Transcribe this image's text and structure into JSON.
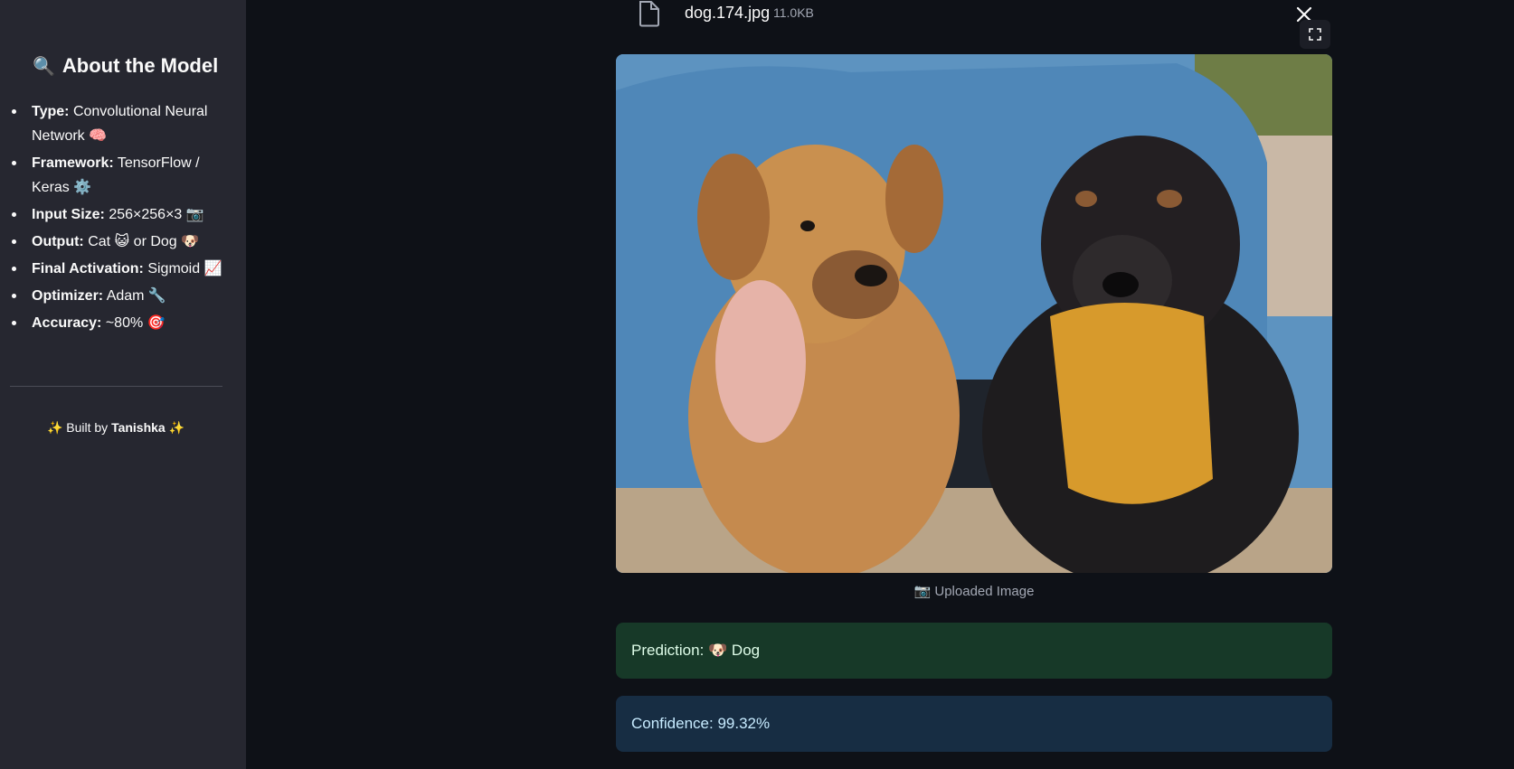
{
  "sidebar": {
    "title": "About the Model",
    "title_icon": "🔍",
    "items": [
      {
        "label": "Type:",
        "value": "Convolutional Neural Network 🧠"
      },
      {
        "label": "Framework:",
        "value": "TensorFlow / Keras ⚙️"
      },
      {
        "label": "Input Size:",
        "value": "256×256×3 📷"
      },
      {
        "label": "Output:",
        "value": "Cat 😺 or Dog 🐶"
      },
      {
        "label": "Final Activation:",
        "value": "Sigmoid 📈"
      },
      {
        "label": "Optimizer:",
        "value": "Adam 🔧"
      },
      {
        "label": "Accuracy:",
        "value": "~80% 🎯"
      }
    ],
    "credit_prefix": "✨ Built by",
    "credit_name": "Tanishka",
    "credit_suffix": "✨"
  },
  "upload": {
    "file_name": "dog.174.jpg",
    "file_size": "11.0KB",
    "caption": "📷 Uploaded Image"
  },
  "results": {
    "prediction": "Prediction: 🐶 Dog",
    "confidence": "Confidence: 99.32%"
  },
  "colors": {
    "app_bg": "#0e1117",
    "sidebar_bg": "#262730",
    "success_bg": "#173928",
    "info_bg": "#172d43"
  }
}
